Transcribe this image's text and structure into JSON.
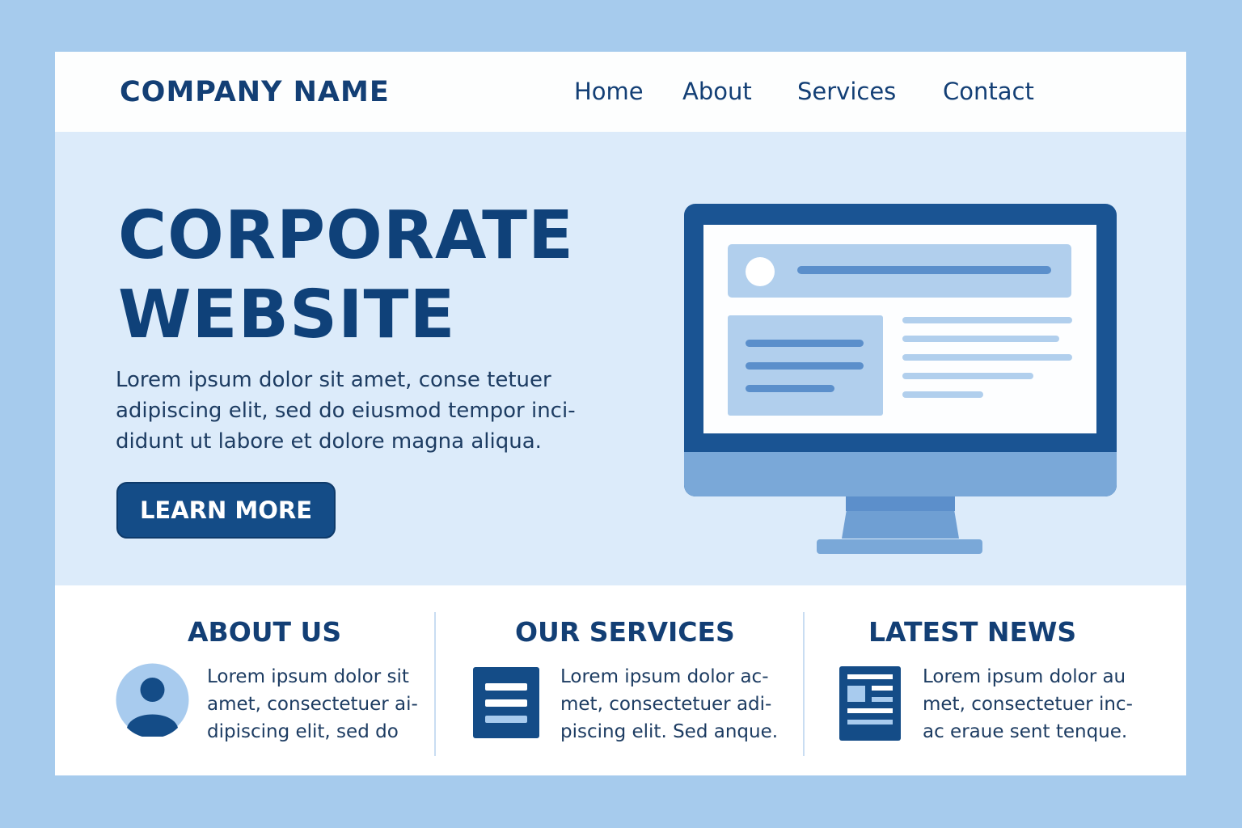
{
  "header": {
    "brand": "COMPANY NAME",
    "nav": [
      "Home",
      "About",
      "Services",
      "Contact"
    ]
  },
  "hero": {
    "title_lines": [
      "CORPORATE",
      "WEBSITE"
    ],
    "body_lines": [
      "Lorem ipsum dolor sit amet, conse tetuer",
      "adipiscing elit, sed do eiusmod tempor inci-",
      "didunt ut labore et dolore magna aliqua."
    ],
    "cta_label": "LEARN MORE",
    "illustration": "desktop-monitor-icon"
  },
  "features": [
    {
      "title": "ABOUT US",
      "icon": "user-avatar-icon",
      "text_lines": [
        "Lorem ipsum dolor sit",
        "amet, consectetuer ai-",
        "dipiscing elit, sed do"
      ]
    },
    {
      "title": "OUR SERVICES",
      "icon": "document-list-icon",
      "text_lines": [
        "Lorem ipsum dolor ac-",
        "met, consectetuer adi-",
        "piscing elit. Sed anque."
      ]
    },
    {
      "title": "LATEST NEWS",
      "icon": "newspaper-icon",
      "text_lines": [
        "Lorem ipsum dolor au",
        "met, consectetuer inc-",
        "ac eraue sent tenque."
      ]
    }
  ],
  "colors": {
    "outer_background": "#a6cbed",
    "hero_background": "#dcebfa",
    "primary_navy": "#133f75",
    "button": "#144c87",
    "accent_light": "#b1cfed"
  }
}
